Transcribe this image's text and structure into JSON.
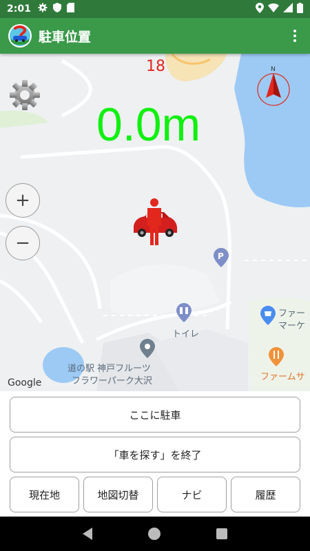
{
  "status_bar": {
    "time": "2:01",
    "icons": [
      "settings-icon",
      "shield-icon",
      "sd-card-icon",
      "location-icon",
      "wifi-icon",
      "signal-icon",
      "battery-icon"
    ]
  },
  "app_bar": {
    "title": "駐車位置",
    "logo_icon": "parking-car-logo-icon",
    "menu_icon": "overflow-menu-icon",
    "color": "#3a9a4a"
  },
  "map": {
    "counter": "18",
    "distance": "0.0m",
    "distance_color": "#10f010",
    "counter_color": "#e2271d",
    "compass_label": "N",
    "zoom_in": "+",
    "zoom_out": "−",
    "attribution": "Google",
    "labels": {
      "station_line1": "道の駅 神戸フルーツ",
      "station_line2": "フラワーパーク大沢",
      "toilet": "トイレ",
      "farmers_market_1": "ファー",
      "farmers_market_2": "マーケ",
      "farm": "ファームサ"
    }
  },
  "controls": {
    "park_here": "ここに駐車",
    "end_search": "「車を探す」を終了",
    "current_location": "現在地",
    "switch_map": "地図切替",
    "navi": "ナビ",
    "history": "履歴"
  }
}
